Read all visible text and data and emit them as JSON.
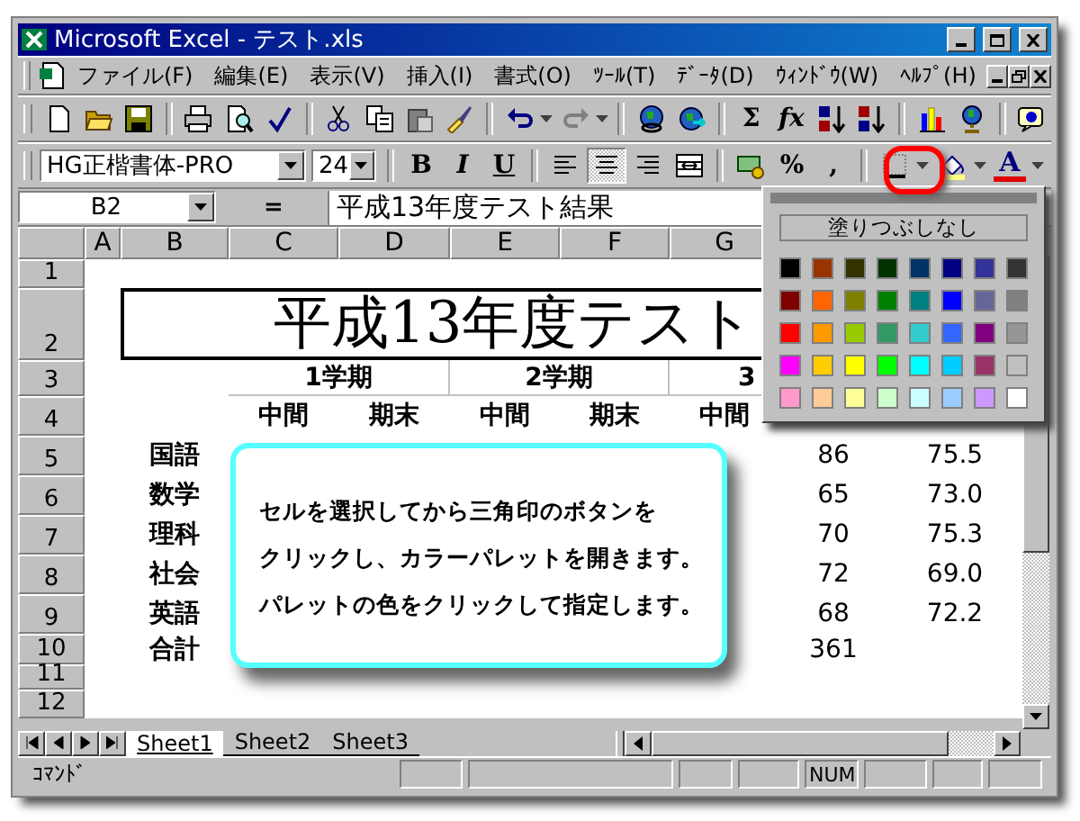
{
  "window": {
    "title": "Microsoft Excel - テスト.xls"
  },
  "menu": [
    "ファイル(F)",
    "編集(E)",
    "表示(V)",
    "挿入(I)",
    "書式(O)",
    "ﾂｰﾙ(T)",
    "ﾃﾞｰﾀ(D)",
    "ｳｨﾝﾄﾞｳ(W)",
    "ﾍﾙﾌﾟ(H)"
  ],
  "standard_toolbar": {
    "sum_label": "Σ",
    "function_label": "fx"
  },
  "format_toolbar": {
    "font": "HG正楷書体-PRO",
    "size": "24",
    "bold_label": "B",
    "italic_label": "I",
    "underline_label": "U",
    "alignment": [
      {
        "selected": false
      },
      {
        "selected": true
      },
      {
        "selected": false
      }
    ],
    "percent_label": "%",
    "comma_label": ",",
    "font_color_label": "A"
  },
  "formula_bar": {
    "name_box": "B2",
    "equals": "=",
    "value": "平成13年度テスト結果"
  },
  "column_headers": [
    "A",
    "B",
    "C",
    "D",
    "E",
    "F",
    "G"
  ],
  "row_headers": [
    "1",
    "2",
    "3",
    "4",
    "5",
    "6",
    "7",
    "8",
    "9",
    "10",
    "11",
    "12"
  ],
  "title_cell": "平成13年度テスト",
  "terms": [
    "1学期",
    "2学期",
    "3"
  ],
  "exams": [
    "中間",
    "期末",
    "中間",
    "期末",
    "中間"
  ],
  "subject_rows": [
    {
      "subject": "国語",
      "column_h": "86",
      "column_i": "75.5"
    },
    {
      "subject": "数学",
      "column_h": "65",
      "column_i": "73.0"
    },
    {
      "subject": "理科",
      "column_h": "70",
      "column_i": "75.3"
    },
    {
      "subject": "社会",
      "column_h": "72",
      "column_i": "69.0"
    },
    {
      "subject": "英語",
      "column_h": "68",
      "column_i": "72.2"
    },
    {
      "subject": "合計",
      "column_h": "361"
    }
  ],
  "callout": {
    "lines": [
      "セルを選択してから三角印のボタンを",
      "クリックし、カラーパレットを開きます。",
      "パレットの色をクリックして指定します。"
    ]
  },
  "palette": {
    "no_fill_label": "塗りつぶしなし",
    "colors": [
      {
        "color": "#000000"
      },
      {
        "color": "#993300"
      },
      {
        "color": "#333300"
      },
      {
        "color": "#003300"
      },
      {
        "color": "#003366"
      },
      {
        "color": "#000080"
      },
      {
        "color": "#333399"
      },
      {
        "color": "#333333"
      },
      {
        "color": "#800000"
      },
      {
        "color": "#ff6600"
      },
      {
        "color": "#808000"
      },
      {
        "color": "#008000"
      },
      {
        "color": "#008080"
      },
      {
        "color": "#0000ff"
      },
      {
        "color": "#666699"
      },
      {
        "color": "#808080"
      },
      {
        "color": "#ff0000"
      },
      {
        "color": "#ff9900"
      },
      {
        "color": "#99cc00"
      },
      {
        "color": "#339966"
      },
      {
        "color": "#33cccc"
      },
      {
        "color": "#3366ff"
      },
      {
        "color": "#800080"
      },
      {
        "color": "#969696"
      },
      {
        "color": "#ff00ff"
      },
      {
        "color": "#ffcc00"
      },
      {
        "color": "#ffff00"
      },
      {
        "color": "#00ff00"
      },
      {
        "color": "#00ffff"
      },
      {
        "color": "#00ccff"
      },
      {
        "color": "#993366"
      },
      {
        "color": "#c0c0c0"
      },
      {
        "color": "#ff99cc"
      },
      {
        "color": "#ffcc99"
      },
      {
        "color": "#ffff99"
      },
      {
        "color": "#ccffcc"
      },
      {
        "color": "#ccffff"
      },
      {
        "color": "#99ccff"
      },
      {
        "color": "#cc99ff"
      },
      {
        "color": "#ffffff"
      }
    ]
  },
  "sheet_tabs": [
    {
      "label": "Sheet1",
      "selected": true
    },
    {
      "label": "Sheet2",
      "selected": false
    },
    {
      "label": "Sheet3",
      "selected": false
    }
  ],
  "status_bar": {
    "mode": "ｺﾏﾝﾄﾞ",
    "indicator": "NUM"
  }
}
